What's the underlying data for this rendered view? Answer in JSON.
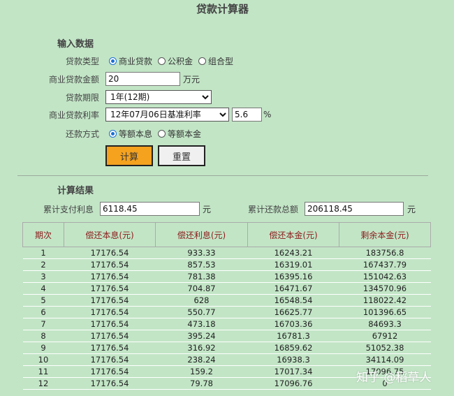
{
  "title": "贷款计算器",
  "input": {
    "section_title": "输入数据",
    "loan_type_label": "贷款类型",
    "loan_type_options": [
      "商业贷款",
      "公积金",
      "组合型"
    ],
    "amount_label": "商业贷款金额",
    "amount_value": "20",
    "amount_unit": "万元",
    "term_label": "贷款期限",
    "term_value": "1年(12期)",
    "rate_label": "商业贷款利率",
    "rate_select_value": "12年07月06日基准利率",
    "rate_value": "5.6",
    "rate_unit": "%",
    "method_label": "还款方式",
    "method_options": [
      "等额本息",
      "等额本金"
    ]
  },
  "buttons": {
    "calc": "计算",
    "reset": "重置"
  },
  "result": {
    "section_title": "计算结果",
    "total_interest_label": "累计支付利息",
    "total_interest_value": "6118.45",
    "total_interest_unit": "元",
    "total_payment_label": "累计还款总额",
    "total_payment_value": "206118.45",
    "total_payment_unit": "元",
    "columns": [
      "期次",
      "偿还本息(元)",
      "偿还利息(元)",
      "偿还本金(元)",
      "剩余本金(元)"
    ],
    "rows": [
      [
        "1",
        "17176.54",
        "933.33",
        "16243.21",
        "183756.8"
      ],
      [
        "2",
        "17176.54",
        "857.53",
        "16319.01",
        "167437.79"
      ],
      [
        "3",
        "17176.54",
        "781.38",
        "16395.16",
        "151042.63"
      ],
      [
        "4",
        "17176.54",
        "704.87",
        "16471.67",
        "134570.96"
      ],
      [
        "5",
        "17176.54",
        "628",
        "16548.54",
        "118022.42"
      ],
      [
        "6",
        "17176.54",
        "550.77",
        "16625.77",
        "101396.65"
      ],
      [
        "7",
        "17176.54",
        "473.18",
        "16703.36",
        "84693.3"
      ],
      [
        "8",
        "17176.54",
        "395.24",
        "16781.3",
        "67912"
      ],
      [
        "9",
        "17176.54",
        "316.92",
        "16859.62",
        "51052.38"
      ],
      [
        "10",
        "17176.54",
        "238.24",
        "16938.3",
        "34114.09"
      ],
      [
        "11",
        "17176.54",
        "159.2",
        "17017.34",
        "17096.75"
      ],
      [
        "12",
        "17176.54",
        "79.78",
        "17096.76",
        "0"
      ]
    ]
  },
  "watermark": "知乎 @稻草人"
}
